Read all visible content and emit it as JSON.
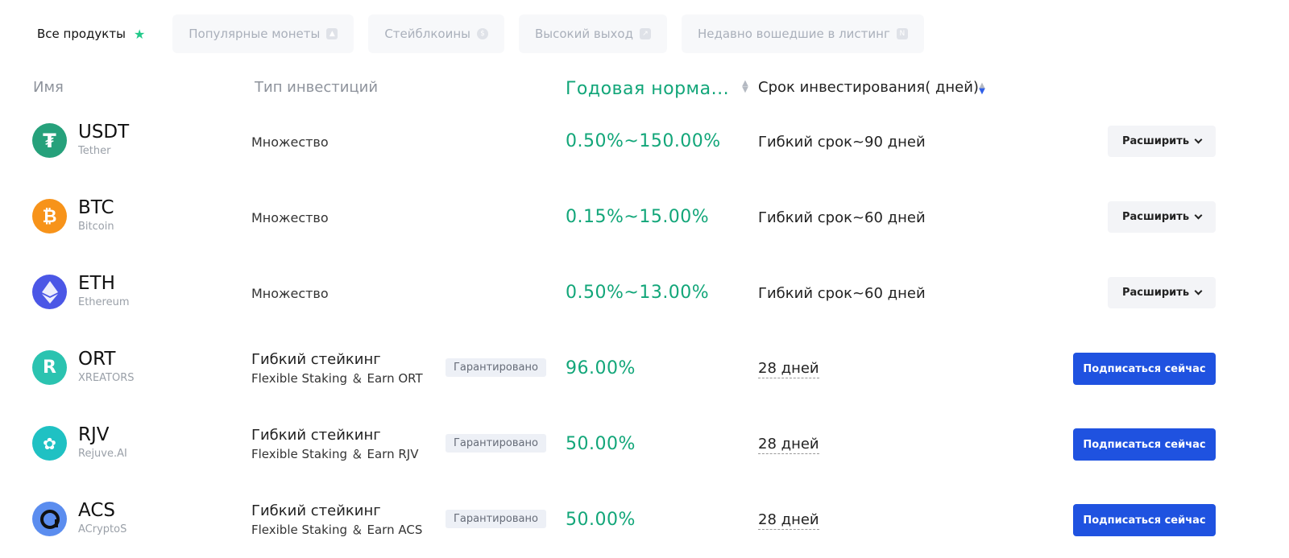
{
  "filters": {
    "all_label": "Все продукты",
    "tabs": [
      {
        "label": "Популярные монеты",
        "icon": "fire-icon"
      },
      {
        "label": "Стейблкоины",
        "icon": "coin-icon"
      },
      {
        "label": "Высокий выход",
        "icon": "chart-icon"
      },
      {
        "label": "Недавно вошедшие в листинг",
        "icon": "new-icon"
      }
    ]
  },
  "table": {
    "headers": {
      "name": "Имя",
      "type": "Тип инвестиций",
      "apr": "Годовая норма...",
      "term": "Срок инвестирования( дней)"
    },
    "rows": [
      {
        "symbol": "USDT",
        "name": "Tether",
        "type": "Множество",
        "apr": "0.50%~150.00%",
        "term": "Гибкий срок~90 дней",
        "action": "Расширить",
        "color": "#26a17b"
      },
      {
        "symbol": "BTC",
        "name": "Bitcoin",
        "type": "Множество",
        "apr": "0.15%~15.00%",
        "term": "Гибкий срок~60 дней",
        "action": "Расширить",
        "color": "#f7931a"
      },
      {
        "symbol": "ETH",
        "name": "Ethereum",
        "type": "Множество",
        "apr": "0.50%~13.00%",
        "term": "Гибкий срок~60 дней",
        "action": "Расширить",
        "color": "#4b57e6"
      },
      {
        "symbol": "ORT",
        "name": "XREATORS",
        "type_title": "Гибкий стейкинг",
        "type_sub": "Flexible Staking ＆ Earn ORT",
        "badge": "Гарантировано",
        "apr": "96.00%",
        "term": "28 дней",
        "action": "Подписаться сейчас",
        "color": "#2bc3b0"
      },
      {
        "symbol": "RJV",
        "name": "Rejuve.AI",
        "type_title": "Гибкий стейкинг",
        "type_sub": "Flexible Staking ＆ Earn RJV",
        "badge": "Гарантировано",
        "apr": "50.00%",
        "term": "28 дней",
        "action": "Подписаться сейчас",
        "color": "#1fc1c3"
      },
      {
        "symbol": "ACS",
        "name": "ACryptoS",
        "type_title": "Гибкий стейкинг",
        "type_sub": "Flexible Staking ＆ Earn ACS",
        "badge": "Гарантировано",
        "apr": "50.00%",
        "term": "28 дней",
        "action": "Подписаться сейчас",
        "color": "#5b8def"
      }
    ]
  }
}
